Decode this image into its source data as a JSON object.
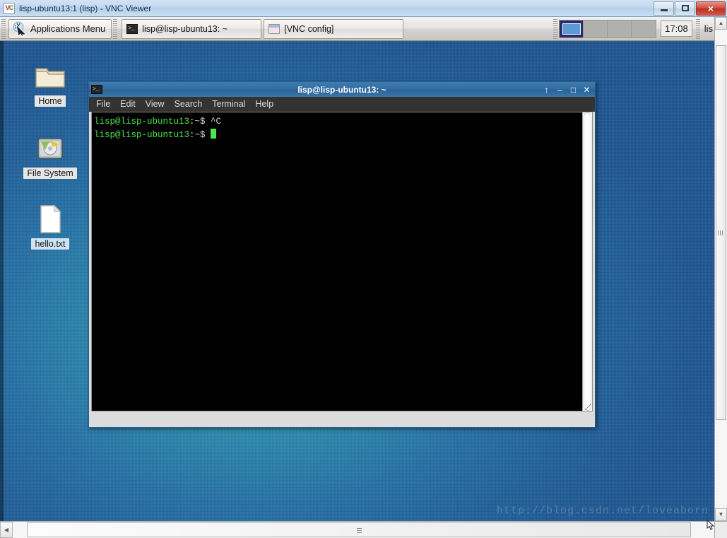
{
  "viewer": {
    "title": "lisp-ubuntu13:1 (lisp) - VNC Viewer",
    "logo_v": "V",
    "logo_c": "C",
    "controls": {
      "minimize": "minimize-button",
      "maximize": "maximize-button",
      "close": "×"
    }
  },
  "panel": {
    "applications_menu": "Applications Menu",
    "tasks": [
      {
        "label": "lisp@lisp-ubuntu13: ~",
        "icon": "terminal-icon",
        "glyph": ">_"
      },
      {
        "label": "[VNC config]",
        "icon": "window-icon",
        "glyph": ""
      }
    ],
    "workspaces": [
      "1",
      "2",
      "3",
      "4"
    ],
    "active_workspace": 0,
    "clock": "17:08",
    "tail_text": "lis"
  },
  "desktop": {
    "icons": [
      {
        "name": "Home",
        "type": "folder",
        "selected": false
      },
      {
        "name": "File System",
        "type": "drive",
        "selected": false
      },
      {
        "name": "hello.txt",
        "type": "text-file",
        "selected": true
      }
    ],
    "watermark": "http://blog.csdn.net/loveaborn"
  },
  "terminal": {
    "title": "lisp@lisp-ubuntu13: ~",
    "icon_glyph": ">_",
    "window_buttons": {
      "shade": "↑",
      "minimize": "–",
      "maximize": "□",
      "close": "✕"
    },
    "menu": [
      "File",
      "Edit",
      "View",
      "Search",
      "Terminal",
      "Help"
    ],
    "lines": [
      {
        "prompt_user": "lisp@lisp-ubuntu13",
        "prompt_path": ":~$",
        "text": " ^C"
      },
      {
        "prompt_user": "lisp@lisp-ubuntu13",
        "prompt_path": ":~$",
        "text": " "
      }
    ],
    "colors": {
      "background": "#000000",
      "prompt": "#4ee44e",
      "text": "#d6d6d6",
      "cursor": "#4ee44e",
      "titlebar": "#336ea3"
    }
  },
  "scrollbars": {
    "vertical": {
      "up": "▲",
      "down": "▼"
    },
    "horizontal": {
      "left": "◀",
      "right": "▶"
    }
  }
}
